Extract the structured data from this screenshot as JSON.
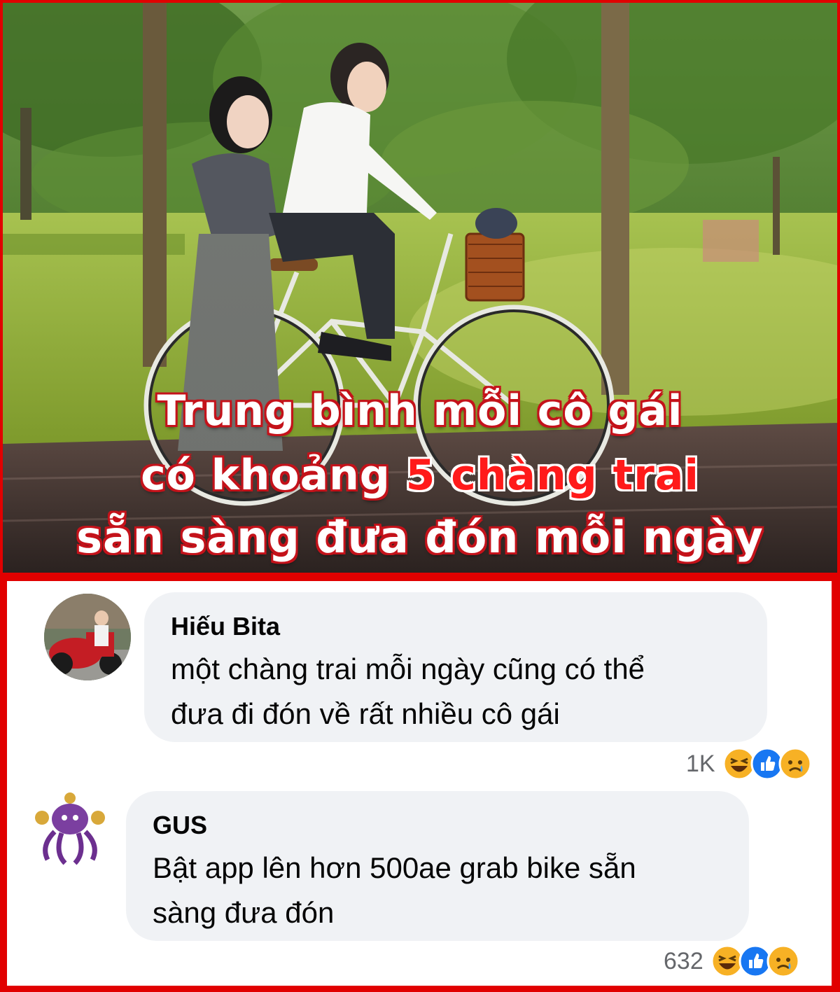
{
  "meme": {
    "caption_line1": "Trung bình mỗi cô gái",
    "caption_line2_pre": "có khoảng ",
    "caption_line2_highlight": "5 chàng trai",
    "caption_line3": "sẵn sàng đưa đón mỗi ngày",
    "highlight_color": "#ff1a1a",
    "frame_color": "#e10000"
  },
  "comments": [
    {
      "author": "Hiếu Bita",
      "text_line1": "một chàng trai mỗi ngày cũng có thể",
      "text_line2": "đưa đi đón về rất nhiều cô gái",
      "reaction_count": "1K",
      "reaction_icons": [
        "haha-icon",
        "like-icon",
        "sad-icon"
      ]
    },
    {
      "author": "GUS",
      "text_line1": "Bật app lên hơn 500ae grab bike sẵn",
      "text_line2": "sàng đưa đón",
      "reaction_count": "632",
      "reaction_icons": [
        "haha-icon",
        "like-icon",
        "sad-icon"
      ]
    }
  ]
}
